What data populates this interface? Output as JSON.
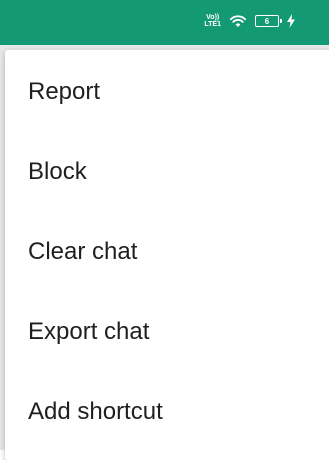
{
  "status_bar": {
    "network_label_top": "Vo))",
    "network_label_bottom": "LTE1",
    "battery_level": "6",
    "icons": [
      "volte-icon",
      "wifi-icon",
      "battery-icon",
      "charging-icon"
    ],
    "background_color": "#139a74"
  },
  "menu": {
    "items": [
      {
        "label": "Report"
      },
      {
        "label": "Block"
      },
      {
        "label": "Clear chat"
      },
      {
        "label": "Export chat"
      },
      {
        "label": "Add shortcut"
      }
    ]
  }
}
